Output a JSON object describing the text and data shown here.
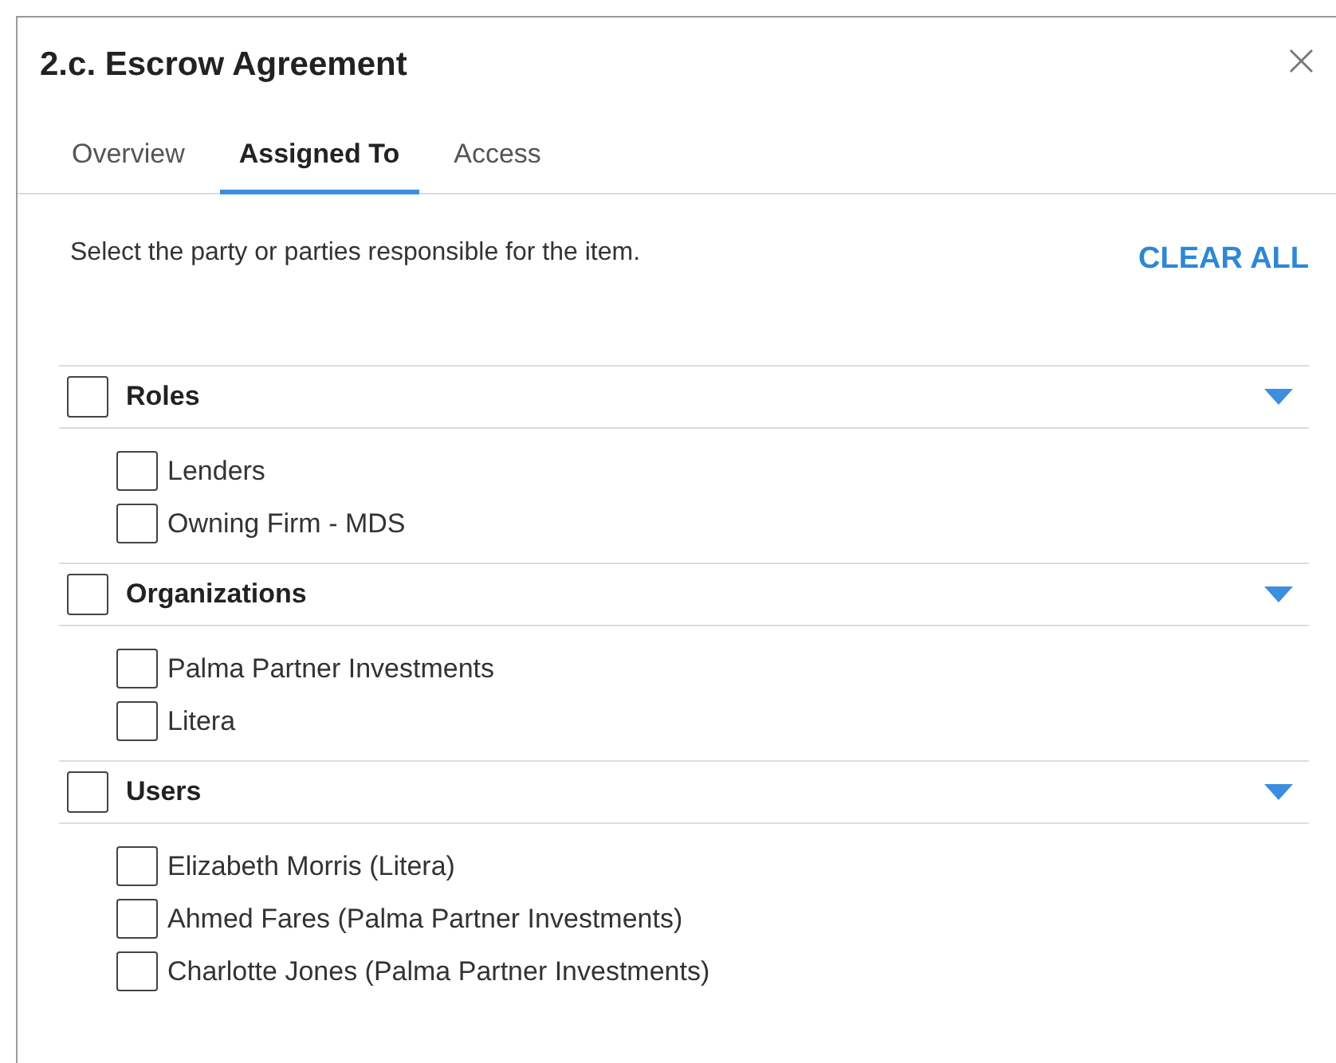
{
  "dialog": {
    "title": "2.c. Escrow Agreement",
    "close": "×"
  },
  "tabs": [
    {
      "label": "Overview",
      "selected": false
    },
    {
      "label": "Assigned To",
      "selected": true
    },
    {
      "label": "Access",
      "selected": false
    }
  ],
  "instructions": "Select the party or parties responsible for the item.",
  "clear_all": "CLEAR ALL",
  "groups": [
    {
      "label": "Roles",
      "checked": false,
      "expanded": true,
      "items": [
        {
          "label": "Lenders",
          "checked": false
        },
        {
          "label": "Owning Firm - MDS",
          "checked": false
        }
      ]
    },
    {
      "label": "Organizations",
      "checked": false,
      "expanded": true,
      "items": [
        {
          "label": "Palma Partner Investments",
          "checked": false
        },
        {
          "label": "Litera",
          "checked": false
        }
      ]
    },
    {
      "label": "Users",
      "checked": false,
      "expanded": true,
      "items": [
        {
          "label": "Elizabeth Morris (Litera)",
          "checked": false
        },
        {
          "label": "Ahmed Fares (Palma Partner Investments)",
          "checked": false
        },
        {
          "label": "Charlotte Jones (Palma Partner Investments)",
          "checked": false
        }
      ]
    }
  ]
}
